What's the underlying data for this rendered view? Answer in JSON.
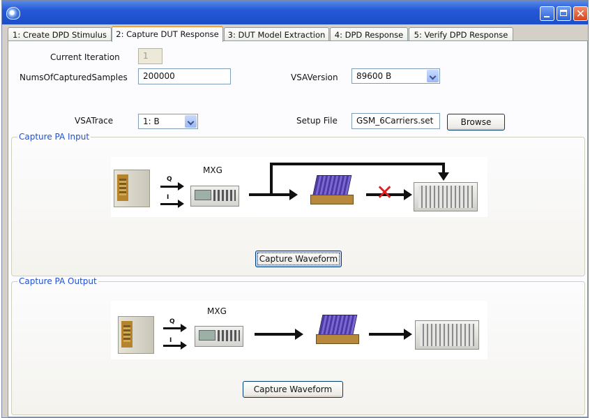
{
  "tabs": [
    {
      "label": "1: Create DPD Stimulus"
    },
    {
      "label": "2: Capture DUT Response"
    },
    {
      "label": "3: DUT Model Extraction"
    },
    {
      "label": "4: DPD Response"
    },
    {
      "label": "5: Verify DPD Response"
    }
  ],
  "form": {
    "current_iteration_label": "Current Iteration",
    "current_iteration_value": "1",
    "num_samples_label": "NumsOfCapturedSamples",
    "num_samples_value": "200000",
    "vsa_version_label": "VSAVersion",
    "vsa_version_value": "89600 B",
    "vsa_trace_label": "VSATrace",
    "vsa_trace_value": "1: B",
    "setup_file_label": "Setup File",
    "setup_file_value": "GSM_6Carriers.set",
    "browse_label": "Browse"
  },
  "capture_input": {
    "legend": "Capture PA Input",
    "mxg_label": "MXG",
    "q_label": "Q",
    "i_label": "I",
    "cross_glyph": "✕",
    "button_label": "Capture Waveform"
  },
  "capture_output": {
    "legend": "Capture PA Output",
    "mxg_label": "MXG",
    "q_label": "Q",
    "i_label": "I",
    "button_label": "Capture Waveform"
  },
  "window": {
    "close_glyph": "✕"
  },
  "colors": {
    "title_bar": "#2458d8",
    "active_tab_accent": "#f3a13a",
    "group_legend": "#2150c8",
    "blocked_cross": "#e02020"
  }
}
